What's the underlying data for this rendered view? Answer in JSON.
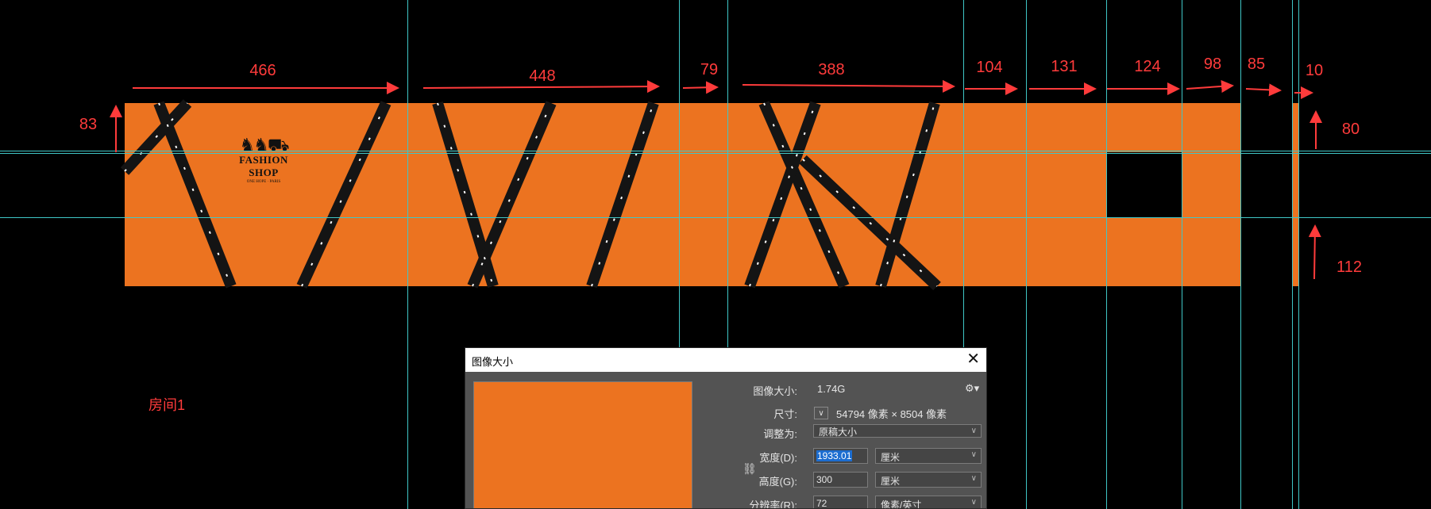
{
  "dimensions": {
    "top": [
      "466",
      "448",
      "79",
      "388",
      "104",
      "131",
      "124",
      "98",
      "85",
      "10"
    ],
    "left": "83",
    "right_top": "80",
    "right_bottom": "112"
  },
  "room_label": "房间1",
  "logo": {
    "name": "FASHION SHOP",
    "tagline": "ONE HOPE · PARIS"
  },
  "colors": {
    "wall": "#ec7320",
    "dimension": "#ff3b3b",
    "guide": "#3fc6c6"
  },
  "dialog": {
    "title": "图像大小",
    "close": "✕",
    "image_size_label": "图像大小:",
    "image_size_value": "1.74G",
    "dimensions_label": "尺寸:",
    "dimensions_value": "54794 像素  ×  8504 像素",
    "fit_label": "调整为:",
    "fit_value": "原稿大小",
    "width_label": "宽度(D):",
    "width_value": "1933.01",
    "width_unit": "厘米",
    "height_label": "高度(G):",
    "height_value": "300",
    "height_unit": "厘米",
    "resolution_label": "分辨率(R):",
    "resolution_value": "72",
    "resolution_unit": "像素/英寸"
  }
}
